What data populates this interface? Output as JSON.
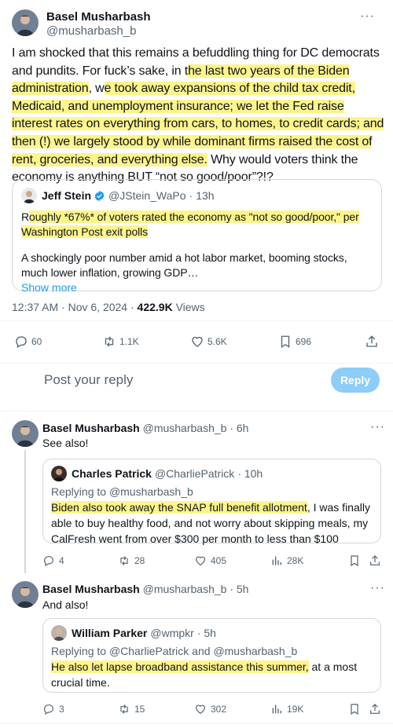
{
  "main_tweet": {
    "author_name": "Basel Musharbash",
    "author_handle": "@musharbash_b",
    "text_parts": [
      "I am shocked that this remains a befuddling thing for DC democrats and pundits. For fuck’s sake, in t",
      "he last two years of the Biden administration",
      ", w",
      "e took away expansions of the child tax credit, Medicaid, and u",
      "nemployment insurance; we let the Fed raise interest rates on everything from cars, to homes, to credit cards; and then (!) we larg",
      "ely stood by while dominant firms raised the cost of rent, groceries, and everything else.",
      " Why would voters think the economy is anything BUT “not so good/poor”?!?"
    ],
    "quote": {
      "author_name": "Jeff Stein",
      "author_handle": "@JStein_WaPo",
      "time": "13h",
      "highlight_text": "R",
      "highlight_text_2": "oughly *67%* of voters rated the economy as \"not so good/poor,\" per Washington Post exit polls",
      "body": "A shockingly poor number amid a hot labor market, booming stocks, much lower inflation, growing GDP…",
      "show_more": "Show more"
    },
    "timestamp": "12:37 AM · Nov 6, 2024 · ",
    "views_count": "422.9K",
    "views_label": " Views",
    "actions": {
      "replies": "60",
      "reposts": "1.1K",
      "likes": "5.6K",
      "bookmarks": "696"
    }
  },
  "reply_box": {
    "placeholder": "Post your reply",
    "button_label": "Reply"
  },
  "replies": [
    {
      "author_name": "Basel Musharbash",
      "author_handle": "@musharbash_b",
      "time": "· 6h",
      "text": "See also!",
      "quote": {
        "author_name": "Charles Patrick",
        "author_handle": "@CharliePatrick",
        "time": "· 10h",
        "replying_prefix": "Replying to ",
        "replying_to": "@musharbash_b",
        "highlight": "Biden also took away the SNAP full benefit allotment",
        "rest": ", I was finally able to buy healthy food, and not worry about skipping meals, my CalFresh went from over $300 per month to less than $100"
      },
      "actions": {
        "replies": "4",
        "reposts": "28",
        "likes": "405",
        "views": "28K"
      }
    },
    {
      "author_name": "Basel Musharbash",
      "author_handle": "@musharbash_b",
      "time": "· 5h",
      "text": "And also!",
      "quote": {
        "author_name": "William Parker",
        "author_handle": "@wmpkr",
        "time": "· 5h",
        "replying_prefix": "Replying to ",
        "replying_to": "@CharliePatrick",
        "replying_and": " and ",
        "replying_to_2": "@musharbash_b",
        "highlight": "He also let lapse broadband assistance this summer,",
        "rest": " at a most crucial time."
      },
      "actions": {
        "replies": "3",
        "reposts": "15",
        "likes": "302",
        "views": "19K"
      }
    }
  ],
  "colors": {
    "highlight": "#fdf58c",
    "link": "#1d9bf0",
    "muted": "#536471",
    "reply_button": "#8ecdf8"
  }
}
